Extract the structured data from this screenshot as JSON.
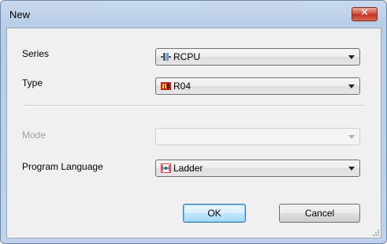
{
  "window": {
    "title": "New",
    "close_symbol": "✕"
  },
  "form": {
    "series": {
      "label": "Series",
      "value": "RCPU",
      "icon": "cpu-module-icon"
    },
    "type": {
      "label": "Type",
      "value": "R04",
      "icon": "plc-unit-icon"
    },
    "mode": {
      "label": "Mode",
      "value": "",
      "disabled": true
    },
    "program_language": {
      "label": "Program Language",
      "value": "Ladder",
      "icon": "ladder-icon"
    }
  },
  "buttons": {
    "ok": "OK",
    "cancel": "Cancel"
  },
  "colors": {
    "accent": "#3c7fb1",
    "close": "#c1321f",
    "disabled_text": "#a0a0a0"
  }
}
